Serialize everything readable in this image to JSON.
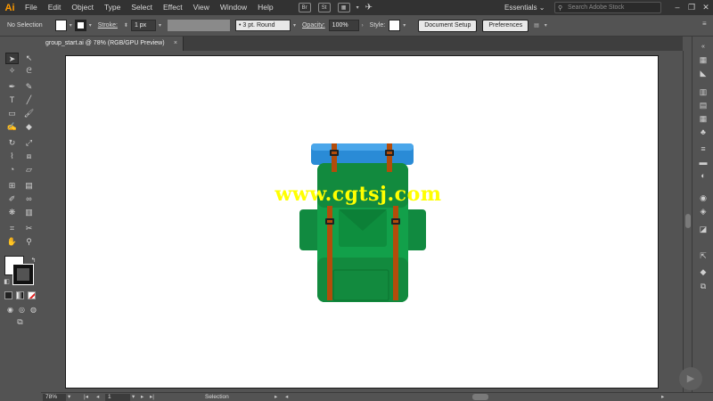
{
  "app": {
    "logo": "Ai"
  },
  "menu": [
    "File",
    "Edit",
    "Object",
    "Type",
    "Select",
    "Effect",
    "View",
    "Window",
    "Help"
  ],
  "menubar_icons": {
    "bridge": "Br",
    "stock": "St"
  },
  "workspace": {
    "label": "Essentials"
  },
  "search": {
    "placeholder": "Search Adobe Stock"
  },
  "control_bar": {
    "selection_status": "No Selection",
    "stroke_label": "Stroke:",
    "stroke_value": "1 px",
    "brush_value": "3 pt. Round",
    "opacity_label": "Opacity:",
    "opacity_value": "100%",
    "style_label": "Style:",
    "document_setup": "Document Setup",
    "preferences": "Preferences"
  },
  "document_tab": {
    "title": "group_start.ai @ 78% (RGB/GPU Preview)",
    "close": "×"
  },
  "watermark": "www.cgtsj.com",
  "status_bar": {
    "zoom": "78%",
    "artboard": "1",
    "tool": "Selection"
  },
  "colors": {
    "backpack_green": "#0f9b48",
    "backpack_green_dark": "#12803c",
    "straps": "#b34c0b",
    "bedroll_blue": "#2a8bd6",
    "watermark": "#ffff00",
    "ai_brand": "#ff9a00"
  }
}
